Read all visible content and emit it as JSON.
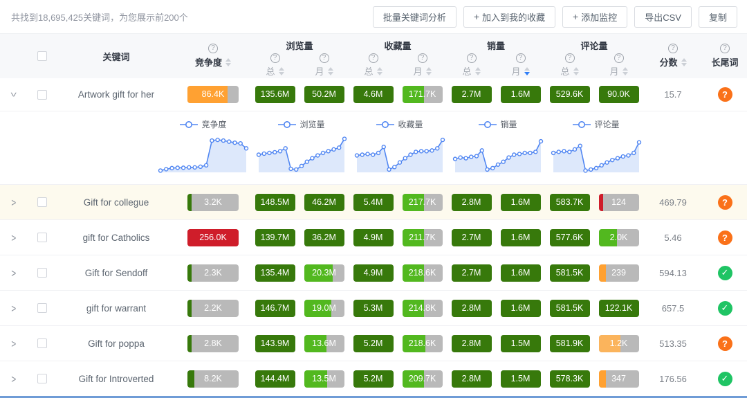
{
  "toolbar": {
    "summary": "共找到18,695,425关键词，为您展示前200个",
    "buttons": [
      {
        "icon": "",
        "label": "批量关键词分析"
      },
      {
        "icon": "+",
        "label": "加入到我的收藏"
      },
      {
        "icon": "+",
        "label": "添加监控"
      },
      {
        "icon": "",
        "label": "导出CSV"
      },
      {
        "icon": "",
        "label": "复制"
      }
    ]
  },
  "colors": {
    "green_dark": "#37790b",
    "green": "#52b81f",
    "orange": "#ffa132",
    "orange_light": "#fbb45c",
    "red": "#cf1d2a",
    "gray": "#b9b9b9",
    "blue": "#5086f2",
    "blue_fill": "#dde8fb",
    "longtail_question": "#fa7119",
    "longtail_check": "#1fc464"
  },
  "table": {
    "headers": {
      "keyword": "关键词",
      "competition": "竞争度",
      "views": "浏览量",
      "favorites": "收藏量",
      "sales": "销量",
      "reviews": "评论量",
      "score": "分数",
      "longtail": "长尾词",
      "total": "总",
      "month": "月"
    },
    "sort_active": "sales.month.desc",
    "rows": [
      {
        "keyword": "Artwork gift for her",
        "expanded": true,
        "highlight": false,
        "comp": {
          "t": "86.4K",
          "c": "orange",
          "f": 78
        },
        "vt": {
          "t": "135.6M",
          "c": "green_dark",
          "f": 100
        },
        "vm": {
          "t": "50.2M",
          "c": "green_dark",
          "f": 100
        },
        "ft": {
          "t": "4.6M",
          "c": "green_dark",
          "f": 100
        },
        "fm": {
          "t": "171.7K",
          "c": "green",
          "f": 55
        },
        "st": {
          "t": "2.7M",
          "c": "green_dark",
          "f": 100
        },
        "sm": {
          "t": "1.6M",
          "c": "green_dark",
          "f": 100
        },
        "rt": {
          "t": "529.6K",
          "c": "green_dark",
          "f": 100
        },
        "rm": {
          "t": "90.0K",
          "c": "green_dark",
          "f": 100
        },
        "score": "15.7",
        "longtail": "question"
      },
      {
        "keyword": "Gift for collegue",
        "expanded": false,
        "highlight": true,
        "comp": {
          "t": "3.2K",
          "c": "green_dark",
          "f": 8
        },
        "vt": {
          "t": "148.5M",
          "c": "green_dark",
          "f": 100
        },
        "vm": {
          "t": "46.2M",
          "c": "green_dark",
          "f": 100
        },
        "ft": {
          "t": "5.4M",
          "c": "green_dark",
          "f": 100
        },
        "fm": {
          "t": "217.7K",
          "c": "green",
          "f": 55
        },
        "st": {
          "t": "2.8M",
          "c": "green_dark",
          "f": 100
        },
        "sm": {
          "t": "1.6M",
          "c": "green_dark",
          "f": 100
        },
        "rt": {
          "t": "583.7K",
          "c": "green_dark",
          "f": 100
        },
        "rm": {
          "t": "124",
          "c": "red",
          "f": 12
        },
        "score": "469.79",
        "longtail": "question"
      },
      {
        "keyword": "gift for Catholics",
        "expanded": false,
        "highlight": false,
        "comp": {
          "t": "256.0K",
          "c": "red",
          "f": 100
        },
        "vt": {
          "t": "139.7M",
          "c": "green_dark",
          "f": 100
        },
        "vm": {
          "t": "36.2M",
          "c": "green_dark",
          "f": 100
        },
        "ft": {
          "t": "4.9M",
          "c": "green_dark",
          "f": 100
        },
        "fm": {
          "t": "211.7K",
          "c": "green",
          "f": 55
        },
        "st": {
          "t": "2.7M",
          "c": "green_dark",
          "f": 100
        },
        "sm": {
          "t": "1.6M",
          "c": "green_dark",
          "f": 100
        },
        "rt": {
          "t": "577.6K",
          "c": "green_dark",
          "f": 100
        },
        "rm": {
          "t": "2.0K",
          "c": "green",
          "f": 45
        },
        "score": "5.46",
        "longtail": "question"
      },
      {
        "keyword": "Gift for Sendoff",
        "expanded": false,
        "highlight": false,
        "comp": {
          "t": "2.3K",
          "c": "green_dark",
          "f": 8
        },
        "vt": {
          "t": "135.4M",
          "c": "green_dark",
          "f": 100
        },
        "vm": {
          "t": "20.3M",
          "c": "green",
          "f": 72
        },
        "ft": {
          "t": "4.9M",
          "c": "green_dark",
          "f": 100
        },
        "fm": {
          "t": "218.6K",
          "c": "green",
          "f": 55
        },
        "st": {
          "t": "2.7M",
          "c": "green_dark",
          "f": 100
        },
        "sm": {
          "t": "1.6M",
          "c": "green_dark",
          "f": 100
        },
        "rt": {
          "t": "581.5K",
          "c": "green_dark",
          "f": 100
        },
        "rm": {
          "t": "239",
          "c": "orange",
          "f": 18
        },
        "score": "594.13",
        "longtail": "check"
      },
      {
        "keyword": "gift for warrant",
        "expanded": false,
        "highlight": false,
        "comp": {
          "t": "2.2K",
          "c": "green_dark",
          "f": 8
        },
        "vt": {
          "t": "146.7M",
          "c": "green_dark",
          "f": 100
        },
        "vm": {
          "t": "19.0M",
          "c": "green",
          "f": 68
        },
        "ft": {
          "t": "5.3M",
          "c": "green_dark",
          "f": 100
        },
        "fm": {
          "t": "214.8K",
          "c": "green",
          "f": 55
        },
        "st": {
          "t": "2.8M",
          "c": "green_dark",
          "f": 100
        },
        "sm": {
          "t": "1.6M",
          "c": "green_dark",
          "f": 100
        },
        "rt": {
          "t": "581.5K",
          "c": "green_dark",
          "f": 100
        },
        "rm": {
          "t": "122.1K",
          "c": "green_dark",
          "f": 100
        },
        "score": "657.5",
        "longtail": "check"
      },
      {
        "keyword": "Gift for poppa",
        "expanded": false,
        "highlight": false,
        "comp": {
          "t": "2.8K",
          "c": "green_dark",
          "f": 8
        },
        "vt": {
          "t": "143.9M",
          "c": "green_dark",
          "f": 100
        },
        "vm": {
          "t": "13.6M",
          "c": "green",
          "f": 56
        },
        "ft": {
          "t": "5.2M",
          "c": "green_dark",
          "f": 100
        },
        "fm": {
          "t": "218.6K",
          "c": "green",
          "f": 57
        },
        "st": {
          "t": "2.8M",
          "c": "green_dark",
          "f": 100
        },
        "sm": {
          "t": "1.5M",
          "c": "green_dark",
          "f": 100
        },
        "rt": {
          "t": "581.9K",
          "c": "green_dark",
          "f": 100
        },
        "rm": {
          "t": "1.2K",
          "c": "orange_light",
          "f": 55
        },
        "score": "513.35",
        "longtail": "question"
      },
      {
        "keyword": "Gift for Introverted",
        "expanded": false,
        "highlight": false,
        "comp": {
          "t": "8.2K",
          "c": "green_dark",
          "f": 14
        },
        "vt": {
          "t": "144.4M",
          "c": "green_dark",
          "f": 100
        },
        "vm": {
          "t": "13.5M",
          "c": "green",
          "f": 57
        },
        "ft": {
          "t": "5.2M",
          "c": "green_dark",
          "f": 100
        },
        "fm": {
          "t": "209.7K",
          "c": "green",
          "f": 55
        },
        "st": {
          "t": "2.8M",
          "c": "green_dark",
          "f": 100
        },
        "sm": {
          "t": "1.5M",
          "c": "green_dark",
          "f": 100
        },
        "rt": {
          "t": "578.3K",
          "c": "green_dark",
          "f": 100
        },
        "rm": {
          "t": "347",
          "c": "orange",
          "f": 18
        },
        "score": "176.56",
        "longtail": "check"
      }
    ]
  },
  "expanded": {
    "after_row": 0,
    "charts": [
      {
        "label": "竞争度",
        "values": [
          5,
          9,
          12,
          13,
          13,
          14,
          14,
          16,
          20,
          90,
          92,
          90,
          87,
          84,
          82,
          68
        ]
      },
      {
        "label": "浏览量",
        "values": [
          50,
          53,
          55,
          57,
          60,
          68,
          10,
          8,
          18,
          30,
          40,
          48,
          55,
          60,
          65,
          70,
          95
        ]
      },
      {
        "label": "收藏量",
        "values": [
          48,
          50,
          52,
          50,
          55,
          72,
          8,
          15,
          28,
          40,
          50,
          58,
          60,
          60,
          62,
          68,
          92
        ]
      },
      {
        "label": "销量",
        "values": [
          38,
          42,
          40,
          44,
          46,
          62,
          8,
          12,
          22,
          30,
          42,
          50,
          52,
          55,
          55,
          58,
          88
        ]
      },
      {
        "label": "评论量",
        "values": [
          55,
          58,
          60,
          58,
          65,
          75,
          5,
          8,
          12,
          20,
          28,
          35,
          40,
          45,
          48,
          55,
          85
        ]
      }
    ]
  }
}
